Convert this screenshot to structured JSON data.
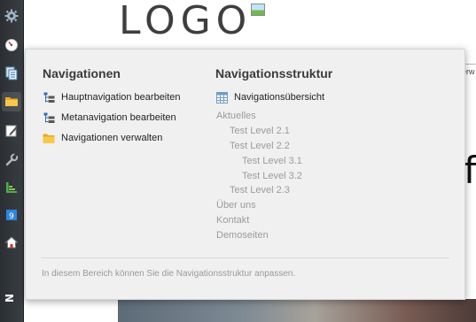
{
  "toolbar": {
    "items": [
      {
        "icon": "gear-icon"
      },
      {
        "icon": "speedometer-icon"
      },
      {
        "icon": "pages-stack-icon"
      },
      {
        "icon": "folder-icon"
      },
      {
        "icon": "edit-pencil-icon"
      },
      {
        "icon": "wrench-icon"
      },
      {
        "icon": "bar-chart-icon"
      },
      {
        "icon": "calendar-icon",
        "badge": "9"
      },
      {
        "icon": "home-icon"
      }
    ],
    "bottom_letter": "N"
  },
  "background": {
    "logo_text": "LOGO",
    "partial_word": "erw",
    "partial_big_letter": "f"
  },
  "flyout": {
    "left_column": {
      "title": "Navigationen",
      "items": [
        {
          "label": "Hauptnavigation bearbeiten",
          "icon": "tree-structure-icon"
        },
        {
          "label": "Metanavigation bearbeiten",
          "icon": "tree-structure-icon"
        },
        {
          "label": "Navigationen verwalten",
          "icon": "folder-icon"
        }
      ]
    },
    "right_column": {
      "title": "Navigationsstruktur",
      "overview_link": {
        "label": "Navigationsübersicht",
        "icon": "sitemap-grid-icon"
      },
      "tree": [
        {
          "label": "Aktuelles",
          "level": 1
        },
        {
          "label": "Test Level 2.1",
          "level": 2
        },
        {
          "label": "Test Level 2.2",
          "level": 2
        },
        {
          "label": "Test Level 3.1",
          "level": 3
        },
        {
          "label": "Test Level 3.2",
          "level": 3
        },
        {
          "label": "Test Level 2.3",
          "level": 2
        },
        {
          "label": "Über uns",
          "level": 1
        },
        {
          "label": "Kontakt",
          "level": 1
        },
        {
          "label": "Demoseiten",
          "level": 1
        }
      ]
    },
    "footer_text": "In diesem Bereich können Sie die Navigationsstruktur anpassen."
  },
  "colors": {
    "toolbar_bg": "#33383d",
    "panel_bg": "#f0f0f0",
    "heading": "#3b3b3b",
    "tree_text": "#9b9b9b",
    "folder_yellow": "#f5c542",
    "tree_icon_blue": "#2f6fb0"
  }
}
